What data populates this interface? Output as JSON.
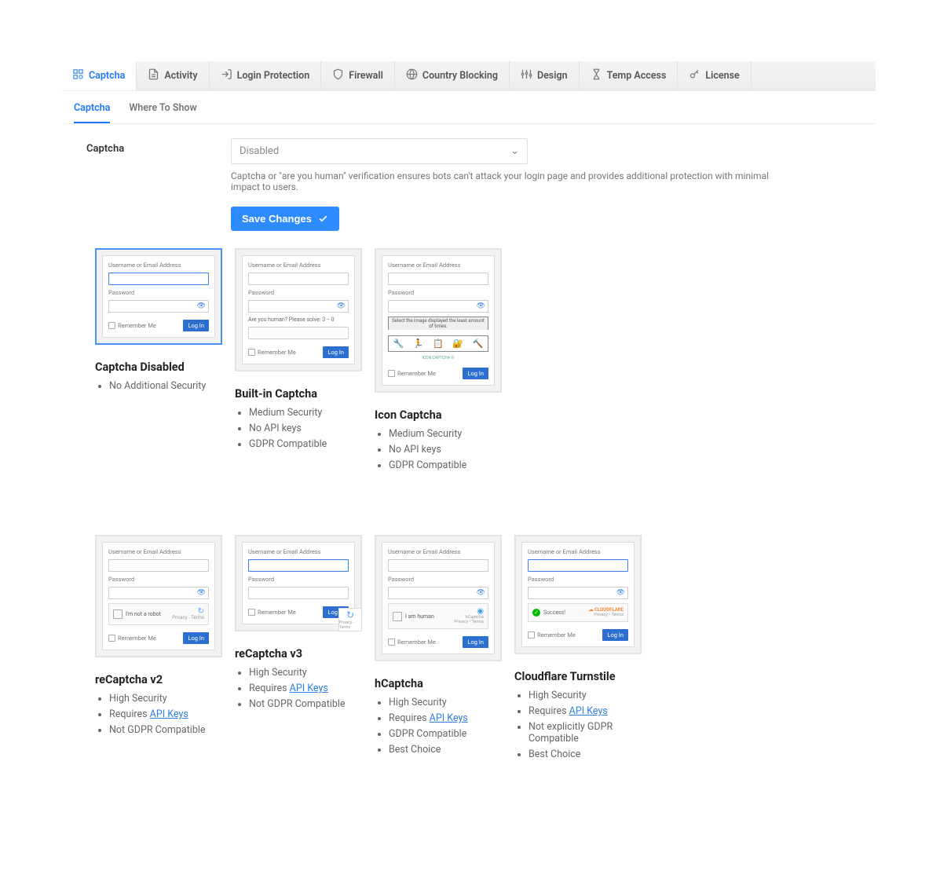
{
  "main_tabs": [
    {
      "label": "Captcha"
    },
    {
      "label": "Activity"
    },
    {
      "label": "Login Protection"
    },
    {
      "label": "Firewall"
    },
    {
      "label": "Country Blocking"
    },
    {
      "label": "Design"
    },
    {
      "label": "Temp Access"
    },
    {
      "label": "License"
    }
  ],
  "sub_tabs": [
    {
      "label": "Captcha"
    },
    {
      "label": "Where To Show"
    }
  ],
  "form": {
    "captcha_label": "Captcha",
    "select_value": "Disabled",
    "help": "Captcha or \"are you human\" verification ensures bots can't attack your login page and provides additional protection with minimal impact to users.",
    "save_btn": "Save Changes"
  },
  "preview_text": {
    "username": "Username or Email Address",
    "password": "Password",
    "remember": "Remember Me",
    "login": "Log In",
    "not_robot": "I'm not a robot",
    "im_human": "I am human",
    "math": "Are you human? Please solve:",
    "math_expr": "3  −  0",
    "icon_head": "Select the image displayed the least amount of times.",
    "icon_foot": "ICON CAPTCHA ©",
    "success": "Success!",
    "cf_brand": "CLOUDFLARE",
    "cf_sub": "Privacy • Terms",
    "hcap_brand": "hCaptcha",
    "hcap_sub": "Privacy • Terms",
    "recap_sub": "Privacy - Terms"
  },
  "api_keys_link": "API Keys",
  "cards": {
    "row1": [
      {
        "title": "Captcha Disabled",
        "bullets": [
          "No Additional Security"
        ]
      },
      {
        "title": "Built-in Captcha",
        "bullets": [
          "Medium Security",
          "No API keys",
          "GDPR Compatible"
        ]
      },
      {
        "title": "Icon Captcha",
        "bullets": [
          "Medium Security",
          "No API keys",
          "GDPR Compatible"
        ]
      }
    ],
    "row2": [
      {
        "title": "reCaptcha v2",
        "bullets": [
          "High Security",
          "Requires ",
          "Not GDPR Compatible"
        ]
      },
      {
        "title": "reCaptcha v3",
        "bullets": [
          "High Security",
          "Requires ",
          "Not GDPR Compatible"
        ]
      },
      {
        "title": "hCaptcha",
        "bullets": [
          "High Security",
          "Requires ",
          "GDPR Compatible",
          "Best Choice"
        ]
      },
      {
        "title": "Cloudflare Turnstile",
        "bullets": [
          "High Security",
          "Requires ",
          "Not explicitly GDPR Compatible",
          "Best Choice"
        ]
      }
    ]
  }
}
